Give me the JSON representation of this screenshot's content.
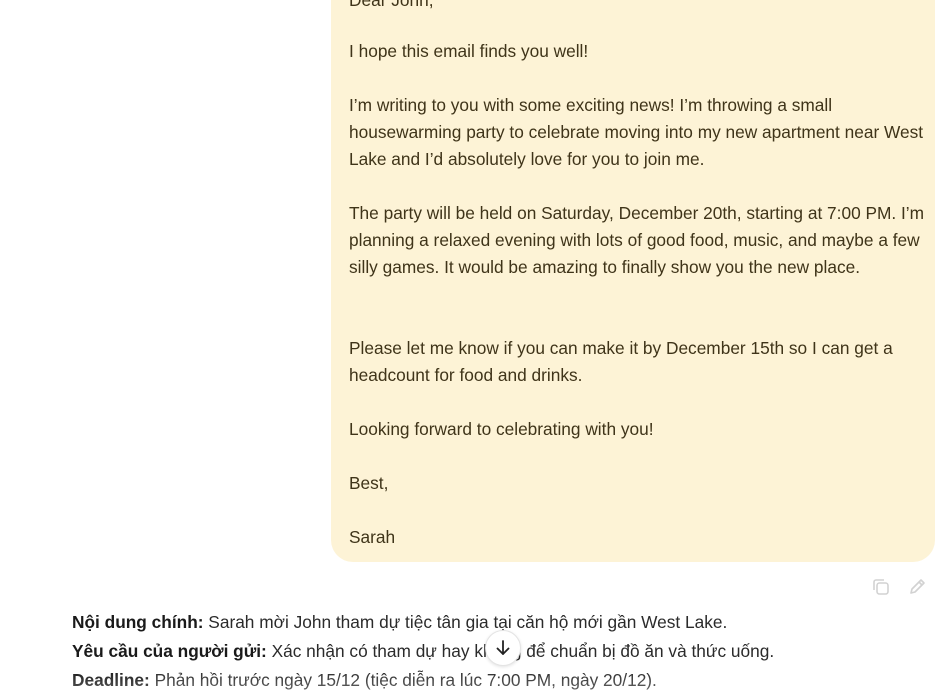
{
  "email": {
    "greeting": "Dear John,",
    "paragraphs": [
      "I hope this email finds you well!",
      "I’m writing to you with some exciting news! I’m throwing a small housewarming party to celebrate moving into my new apartment near West Lake and I’d absolutely love for you to join me.",
      "The party will be held on Saturday, December 20th, starting at 7:00 PM. I’m planning a relaxed evening with lots of good food, music, and maybe a few silly games. It would be amazing to finally show you the new place.",
      "Please let me know if you can make it by December 15th so I can get a headcount for food and drinks.",
      "Looking forward to celebrating with you!",
      "Best,",
      "Sarah"
    ]
  },
  "message_actions": {
    "copy_icon": "copy-icon",
    "edit_icon": "pencil-icon"
  },
  "summary": {
    "main_label": "Nội dung chính:",
    "main_text": " Sarah mời John tham dự tiệc tân gia tại căn hộ mới gần West Lake.",
    "request_label": "Yêu cầu của người gửi:",
    "request_text": " Xác nhận có tham dự hay không để chuẩn bị đồ ăn và thức uống.",
    "deadline_label": "Deadline:",
    "deadline_text": " Phản hồi trước ngày 15/12 (tiệc diễn ra lúc 7:00 PM, ngày 20/12)."
  },
  "scroll_button": {
    "icon": "arrow-down-icon"
  }
}
